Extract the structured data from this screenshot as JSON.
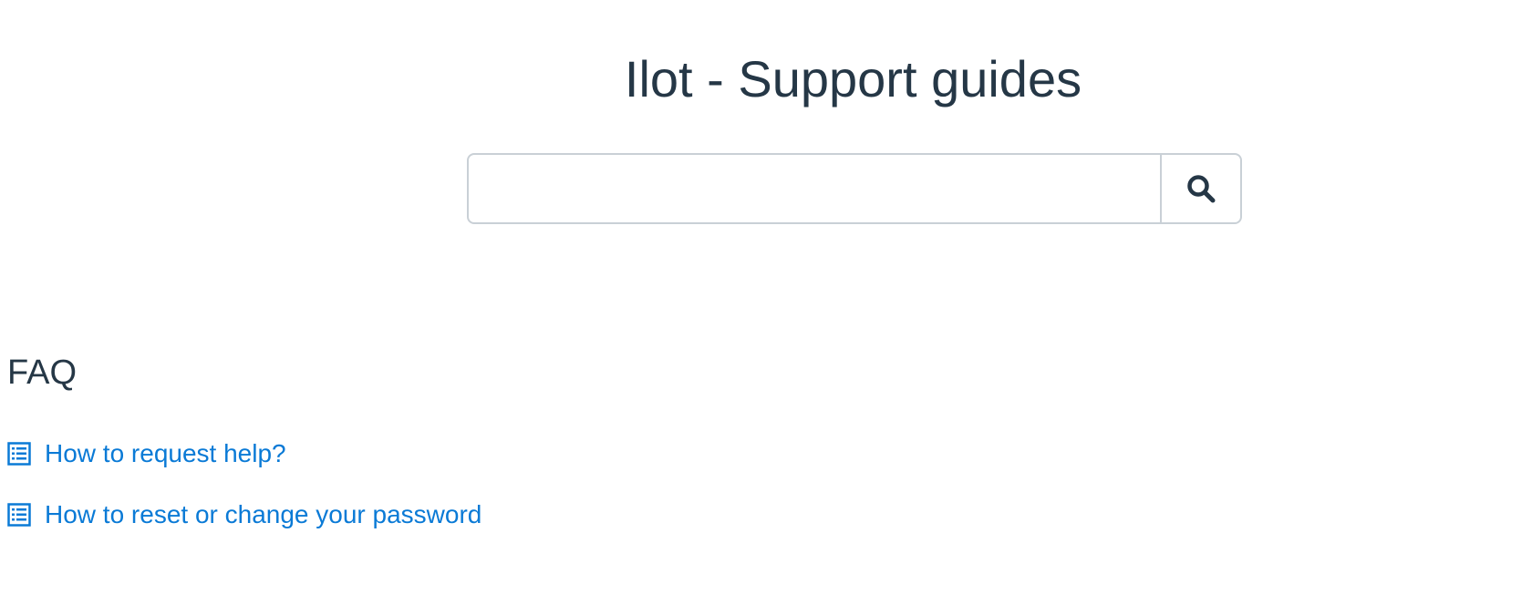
{
  "header": {
    "title": "Ilot - Support guides"
  },
  "search": {
    "value": "",
    "placeholder": "",
    "button_icon": "search-icon"
  },
  "faq": {
    "title": "FAQ",
    "items": [
      {
        "label": "How to request help?",
        "icon": "article-list-icon"
      },
      {
        "label": "How to reset or change your password",
        "icon": "article-list-icon"
      }
    ]
  },
  "colors": {
    "text": "#253746",
    "link": "#0a7ad6",
    "border": "#c9d0d6"
  }
}
